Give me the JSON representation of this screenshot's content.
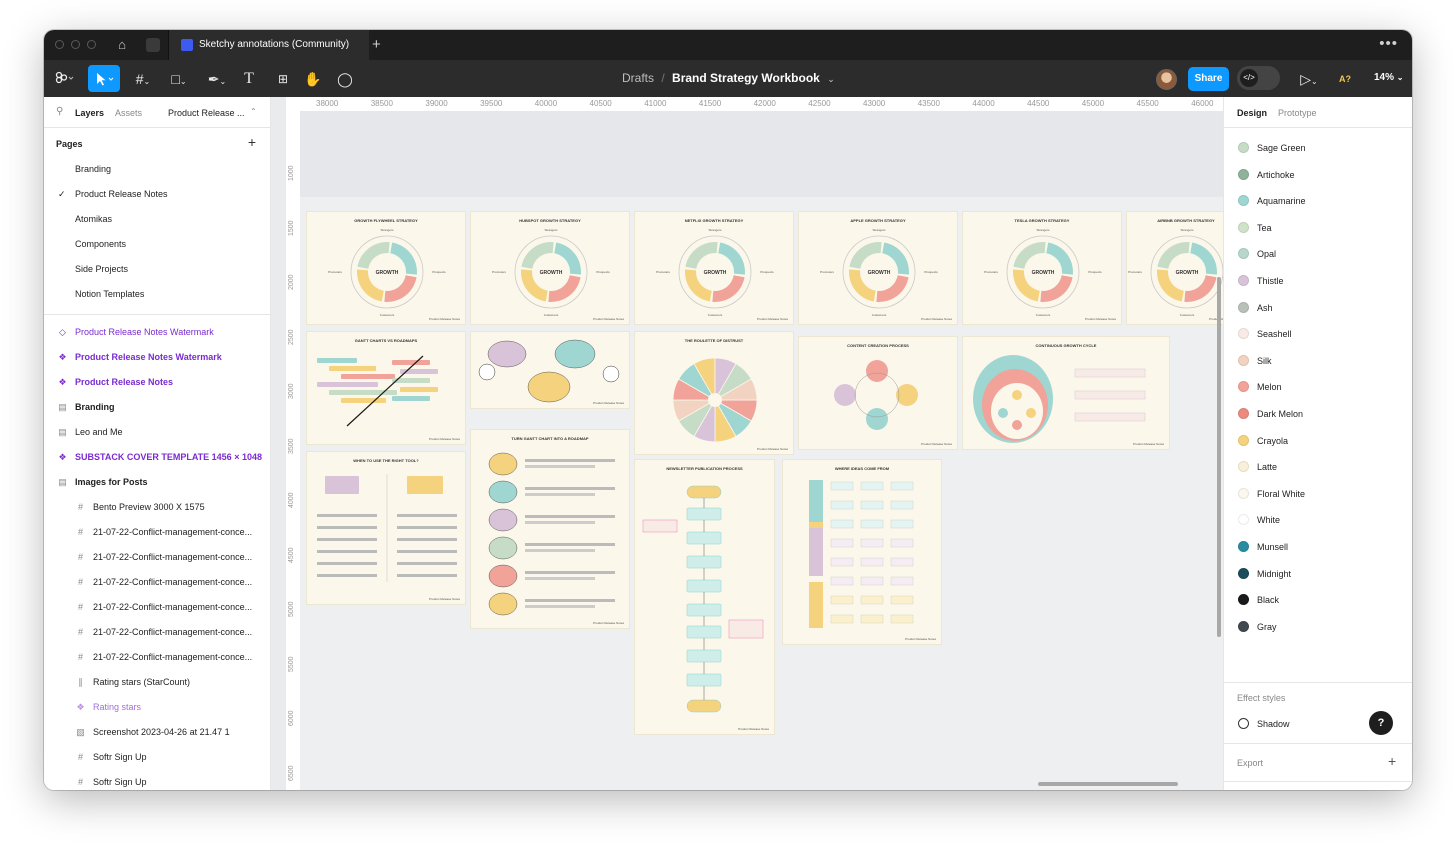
{
  "titlebar": {
    "tab_title": "Sketchy annotations (Community)",
    "plus": "+",
    "more": "•••"
  },
  "toolbar": {
    "breadcrumb_folder": "Drafts",
    "separator": "/",
    "file_name": "Brand Strategy Workbook",
    "file_caret": "⌄",
    "share_label": "Share",
    "dev_mode_label": "</>",
    "a11y_label": "A?",
    "zoom": "14%"
  },
  "left_panel": {
    "tab_layers": "Layers",
    "tab_assets": "Assets",
    "page_selector": "Product Release ...",
    "pages_heading": "Pages",
    "pages_add": "+",
    "pages": [
      {
        "label": "Branding",
        "current": false
      },
      {
        "label": "Product Release Notes",
        "current": true
      },
      {
        "label": "Atomikas",
        "current": false
      },
      {
        "label": "Components",
        "current": false
      },
      {
        "label": "Side Projects",
        "current": false
      },
      {
        "label": "Notion Templates",
        "current": false
      }
    ],
    "current_check": "✓",
    "layers": [
      {
        "label": "Product Release Notes Watermark",
        "icon": "diamond-outline-icon",
        "style": "purple",
        "child": false
      },
      {
        "label": "Product Release Notes Watermark",
        "icon": "component-icon",
        "style": "purple-bold",
        "child": false
      },
      {
        "label": "Product Release Notes",
        "icon": "component-icon",
        "style": "purple-bold",
        "child": false
      },
      {
        "label": "Branding",
        "icon": "section-icon",
        "style": "bold",
        "child": false
      },
      {
        "label": "Leo and Me",
        "icon": "section-icon",
        "style": "normal",
        "child": false
      },
      {
        "label": "SUBSTACK COVER TEMPLATE 1456 × 1048",
        "icon": "component-icon",
        "style": "purple-bold",
        "child": false
      },
      {
        "label": "Images for Posts",
        "icon": "section-icon",
        "style": "bold",
        "child": false
      },
      {
        "label": "Bento Preview 3000 X 1575",
        "icon": "frame-icon",
        "style": "normal",
        "child": true
      },
      {
        "label": "21-07-22-Conflict-management-conce...",
        "icon": "frame-icon",
        "style": "normal",
        "child": true
      },
      {
        "label": "21-07-22-Conflict-management-conce...",
        "icon": "frame-icon",
        "style": "normal",
        "child": true
      },
      {
        "label": "21-07-22-Conflict-management-conce...",
        "icon": "frame-icon",
        "style": "normal",
        "child": true
      },
      {
        "label": "21-07-22-Conflict-management-conce...",
        "icon": "frame-icon",
        "style": "normal",
        "child": true
      },
      {
        "label": "21-07-22-Conflict-management-conce...",
        "icon": "frame-icon",
        "style": "normal",
        "child": true
      },
      {
        "label": "21-07-22-Conflict-management-conce...",
        "icon": "frame-icon",
        "style": "normal",
        "child": true
      },
      {
        "label": "Rating stars (StarCount)",
        "icon": "instance-icon",
        "style": "normal",
        "child": true
      },
      {
        "label": "Rating stars",
        "icon": "component-light-icon",
        "style": "purple",
        "child": true
      },
      {
        "label": "Screenshot 2023-04-26 at 21.47 1",
        "icon": "image-icon",
        "style": "normal",
        "child": true
      },
      {
        "label": "Softr Sign Up",
        "icon": "frame-icon",
        "style": "normal",
        "child": true
      },
      {
        "label": "Softr Sign Up",
        "icon": "frame-icon",
        "style": "normal",
        "child": true
      }
    ]
  },
  "ruler": {
    "top": [
      "38000",
      "38500",
      "39000",
      "39500",
      "40000",
      "40500",
      "41000",
      "41500",
      "42000",
      "42500",
      "43000",
      "43500",
      "44000",
      "44500",
      "45000",
      "45500",
      "46000"
    ],
    "left": [
      "1000",
      "1500",
      "2000",
      "2500",
      "3000",
      "3500",
      "4000",
      "4500",
      "5000",
      "5500",
      "6000",
      "6500"
    ]
  },
  "canvas": {
    "watermark": "Product Release Notes",
    "center_word": "GROWTH",
    "flywheel_labels": [
      "Strangers",
      "Prospects",
      "Customers",
      "Promoters"
    ],
    "frames": [
      {
        "title": "GROWTH FLYWHEEL STRATEGY",
        "kind": "flywheel"
      },
      {
        "title": "HUBSPOT GROWTH STRATEGY",
        "kind": "flywheel"
      },
      {
        "title": "NETFLIX GROWTH STRATEGY",
        "kind": "flywheel"
      },
      {
        "title": "APPLE GROWTH STRATEGY",
        "kind": "flywheel"
      },
      {
        "title": "TESLA GROWTH STRATEGY",
        "kind": "flywheel"
      },
      {
        "title": "AIRBNB GROWTH STRATEGY",
        "kind": "flywheel"
      },
      {
        "title": "GANTT CHARTS VS ROADMAPS",
        "kind": "gantt"
      },
      {
        "title": "",
        "kind": "bubbles"
      },
      {
        "title": "THE ROULETTE OF DISTRUST",
        "kind": "roulette"
      },
      {
        "title": "CONTENT CREATION PROCESS",
        "kind": "process"
      },
      {
        "title": "CONTINUOUS GROWTH CYCLE",
        "kind": "cycle"
      },
      {
        "title": "WHEN TO USE THE RIGHT TOOL?",
        "kind": "tool"
      },
      {
        "title": "TURN GANTT CHART INTO A ROADMAP",
        "kind": "steps"
      },
      {
        "title": "NEWSLETTER PUBLICATION PROCESS",
        "kind": "flow"
      },
      {
        "title": "WHERE IDEAS COME FROM",
        "kind": "ideas"
      }
    ]
  },
  "right_panel": {
    "tab_design": "Design",
    "tab_prototype": "Prototype",
    "colors": [
      {
        "name": "Sage Green",
        "hex": "#c6dcc6"
      },
      {
        "name": "Artichoke",
        "hex": "#8fb39a"
      },
      {
        "name": "Aquamarine",
        "hex": "#9fd6d2"
      },
      {
        "name": "Tea",
        "hex": "#cfe3c8"
      },
      {
        "name": "Opal",
        "hex": "#b8d6cc"
      },
      {
        "name": "Thistle",
        "hex": "#d9c3d9"
      },
      {
        "name": "Ash",
        "hex": "#b8c0b8"
      },
      {
        "name": "Seashell",
        "hex": "#f8ebe6"
      },
      {
        "name": "Silk",
        "hex": "#f2d3c1"
      },
      {
        "name": "Melon",
        "hex": "#f1a39a"
      },
      {
        "name": "Dark Melon",
        "hex": "#ec8a7e"
      },
      {
        "name": "Crayola",
        "hex": "#f5d27e"
      },
      {
        "name": "Latte",
        "hex": "#f8f0d8"
      },
      {
        "name": "Floral White",
        "hex": "#fbf8ee"
      },
      {
        "name": "White",
        "hex": "#ffffff"
      },
      {
        "name": "Munsell",
        "hex": "#2a8ca0"
      },
      {
        "name": "Midnight",
        "hex": "#1b4d5c"
      },
      {
        "name": "Black",
        "hex": "#1a1a1a"
      },
      {
        "name": "Gray",
        "hex": "#404850"
      }
    ],
    "effect_styles_heading": "Effect styles",
    "effect_shadow": "Shadow",
    "export_heading": "Export",
    "export_add": "+",
    "help": "?"
  }
}
